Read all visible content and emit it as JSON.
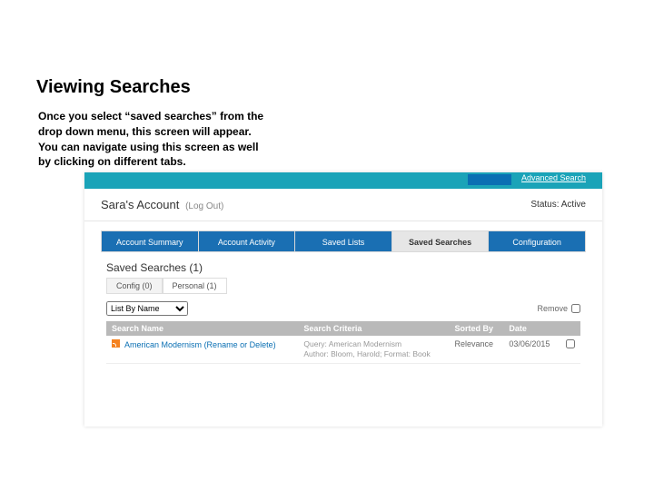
{
  "slide": {
    "title": "Viewing Searches",
    "annotation": "Once you select “saved searches” from the drop down menu, this screen will appear. You can navigate using this screen as well by clicking on different tabs."
  },
  "header": {
    "advanced_search": "Advanced Search"
  },
  "account": {
    "name": "Sara's Account",
    "logout": "(Log Out)",
    "status_label": "Status:",
    "status_value": "Active"
  },
  "tabs": [
    {
      "label": "Account Summary",
      "style": "blue"
    },
    {
      "label": "Account Activity",
      "style": "blue"
    },
    {
      "label": "Saved Lists",
      "style": "blue"
    },
    {
      "label": "Saved Searches",
      "style": "active"
    },
    {
      "label": "Configuration",
      "style": "blue"
    }
  ],
  "section": {
    "title": "Saved Searches (1)",
    "subtabs": [
      {
        "label": "Config (0)"
      },
      {
        "label": "Personal (1)",
        "active": true
      }
    ]
  },
  "sort": {
    "options": [
      "List By Name"
    ],
    "remove_label": "Remove"
  },
  "table": {
    "headers": [
      "Search Name",
      "Search Criteria",
      "Sorted By",
      "Date",
      ""
    ],
    "rows": [
      {
        "name": "American Modernism",
        "name_suffix": "(Rename or Delete)",
        "criteria_line1": "Query: American Modernism",
        "criteria_line2": "Author: Bloom, Harold; Format: Book",
        "sorted_by": "Relevance",
        "date": "03/06/2015"
      }
    ]
  }
}
